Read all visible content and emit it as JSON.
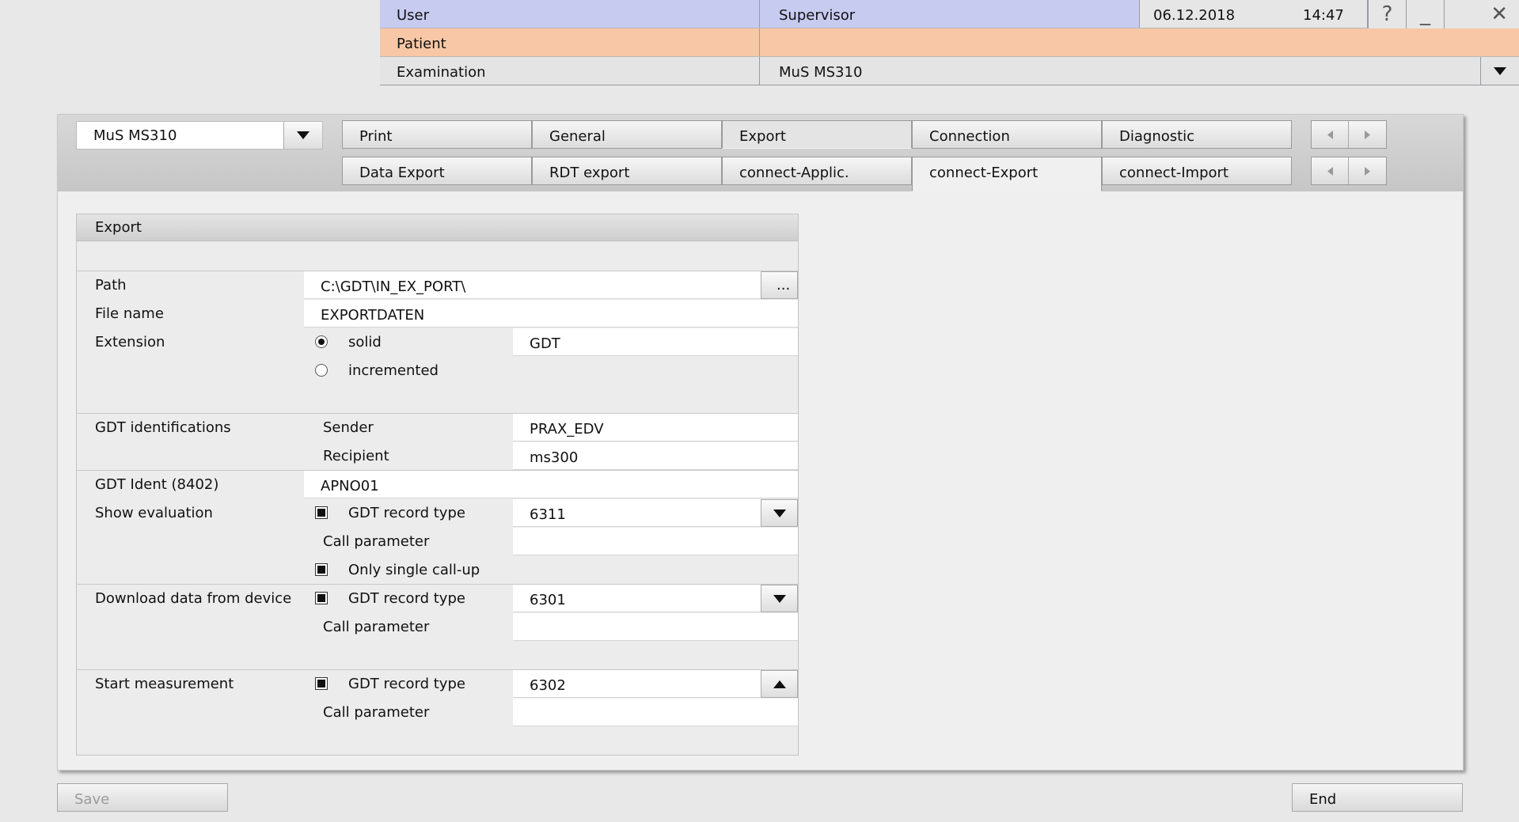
{
  "header": {
    "user_label": "User",
    "user_value": "Supervisor",
    "date": "06.12.2018",
    "time": "14:47",
    "help_glyph": "?",
    "minimize_glyph": "_",
    "close_glyph": "✕",
    "patient_label": "Patient",
    "patient_value": "",
    "examination_label": "Examination",
    "examination_value": "MuS MS310",
    "colors": {
      "user_row": "#c7cbf0",
      "patient_row": "#f7c7a6",
      "exam_row": "#e4e4e4"
    }
  },
  "device_select": {
    "value": "MuS MS310"
  },
  "tabs_row1": [
    {
      "label": "Print",
      "active": false
    },
    {
      "label": "General",
      "active": false
    },
    {
      "label": "Export",
      "active": true
    },
    {
      "label": "Connection",
      "active": false
    },
    {
      "label": "Diagnostic",
      "active": false
    }
  ],
  "tabs_row2": [
    {
      "label": "Data Export",
      "active": false
    },
    {
      "label": "RDT export",
      "active": false
    },
    {
      "label": "connect-Applic.",
      "active": false
    },
    {
      "label": "connect-Export",
      "active": true
    },
    {
      "label": "connect-Import",
      "active": false
    }
  ],
  "form": {
    "title": "Export",
    "path_label": "Path",
    "path_value": "C:\\GDT\\IN_EX_PORT\\",
    "browse_label": "...",
    "filename_label": "File name",
    "filename_value": "EXPORTDATEN",
    "extension_label": "Extension",
    "ext_solid_label": "solid",
    "ext_solid_checked": true,
    "ext_solid_value": "GDT",
    "ext_incremented_label": "incremented",
    "ext_incremented_checked": false,
    "gdt_ident_label": "GDT identifications",
    "sender_label": "Sender",
    "sender_value": "PRAX_EDV",
    "recipient_label": "Recipient",
    "recipient_value": "ms300",
    "gdt_ident8402_label": "GDT Ident (8402)",
    "gdt_ident8402_value": "APNO01",
    "show_eval_label": "Show evaluation",
    "show_eval_record_label": "GDT record type",
    "show_eval_checked": true,
    "show_eval_record_value": "6311",
    "show_eval_callparam_label": "Call parameter",
    "show_eval_callparam_value": "",
    "single_callup_label": "Only single call-up",
    "single_callup_checked": true,
    "download_label": "Download data from device",
    "download_record_label": "GDT record type",
    "download_checked": true,
    "download_record_value": "6301",
    "download_callparam_label": "Call parameter",
    "download_callparam_value": "",
    "start_label": "Start measurement",
    "start_record_label": "GDT record type",
    "start_checked": true,
    "start_record_value": "6302",
    "start_callparam_label": "Call parameter",
    "start_callparam_value": ""
  },
  "footer": {
    "save_label": "Save",
    "end_label": "End"
  }
}
